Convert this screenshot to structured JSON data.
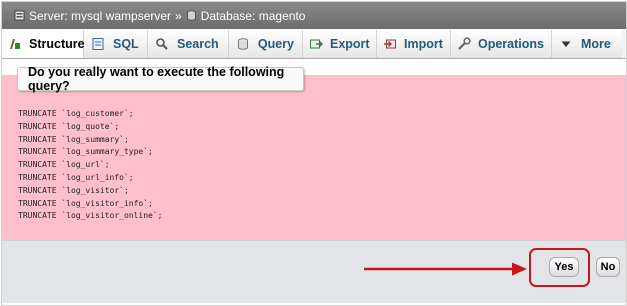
{
  "breadcrumb": {
    "server_label": "Server: mysql wampserver",
    "separator": "»",
    "database_label": "Database: magento"
  },
  "tabs": [
    {
      "label": "Structure",
      "icon": "structure-icon",
      "active": true
    },
    {
      "label": "SQL",
      "icon": "sql-icon"
    },
    {
      "label": "Search",
      "icon": "search-icon"
    },
    {
      "label": "Query",
      "icon": "query-icon"
    },
    {
      "label": "Export",
      "icon": "export-icon"
    },
    {
      "label": "Import",
      "icon": "import-icon"
    },
    {
      "label": "Operations",
      "icon": "operations-icon"
    },
    {
      "label": "More",
      "icon": "chevron-down-icon"
    }
  ],
  "dialog": {
    "title": "Do you really want to execute the following query?"
  },
  "query_lines": [
    "TRUNCATE `log_customer`;",
    "TRUNCATE `log_quote`;",
    "TRUNCATE `log_summary`;",
    "TRUNCATE `log_summary_type`;",
    "TRUNCATE `log_url`;",
    "TRUNCATE `log_url_info`;",
    "TRUNCATE `log_visitor`;",
    "TRUNCATE `log_visitor_info`;",
    "TRUNCATE `log_visitor_online`;"
  ],
  "buttons": {
    "yes_label": "Yes",
    "no_label": "No"
  },
  "colors": {
    "confirm_background": "#ffc0cb",
    "annotation_red": "#c8151d",
    "tab_text": "#235a81"
  }
}
